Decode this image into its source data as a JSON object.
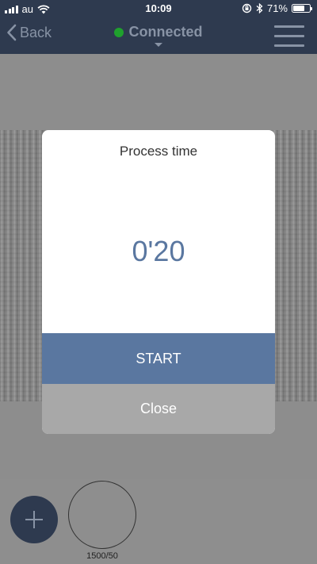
{
  "status_bar": {
    "carrier": "au",
    "time": "10:09",
    "battery_percent": "71%",
    "battery_level": 0.71,
    "icons": [
      "signal-icon",
      "wifi-icon",
      "rotation-lock-icon",
      "bluetooth-icon",
      "battery-icon"
    ]
  },
  "nav": {
    "back_label": "Back",
    "connection_status": "Connected",
    "connection_color": "#1fa12d",
    "icons": [
      "chevron-left-icon",
      "chevron-down-icon",
      "hamburger-menu-icon"
    ]
  },
  "modal": {
    "title": "Process time",
    "time_value": "0'20",
    "start_label": "START",
    "close_label": "Close"
  },
  "bottom": {
    "preset_label": "1500/50",
    "icons": [
      "plus-icon"
    ]
  },
  "colors": {
    "navbar": "#2e3a4f",
    "accent": "#5a77a0",
    "close_button": "#a8a8a8"
  }
}
